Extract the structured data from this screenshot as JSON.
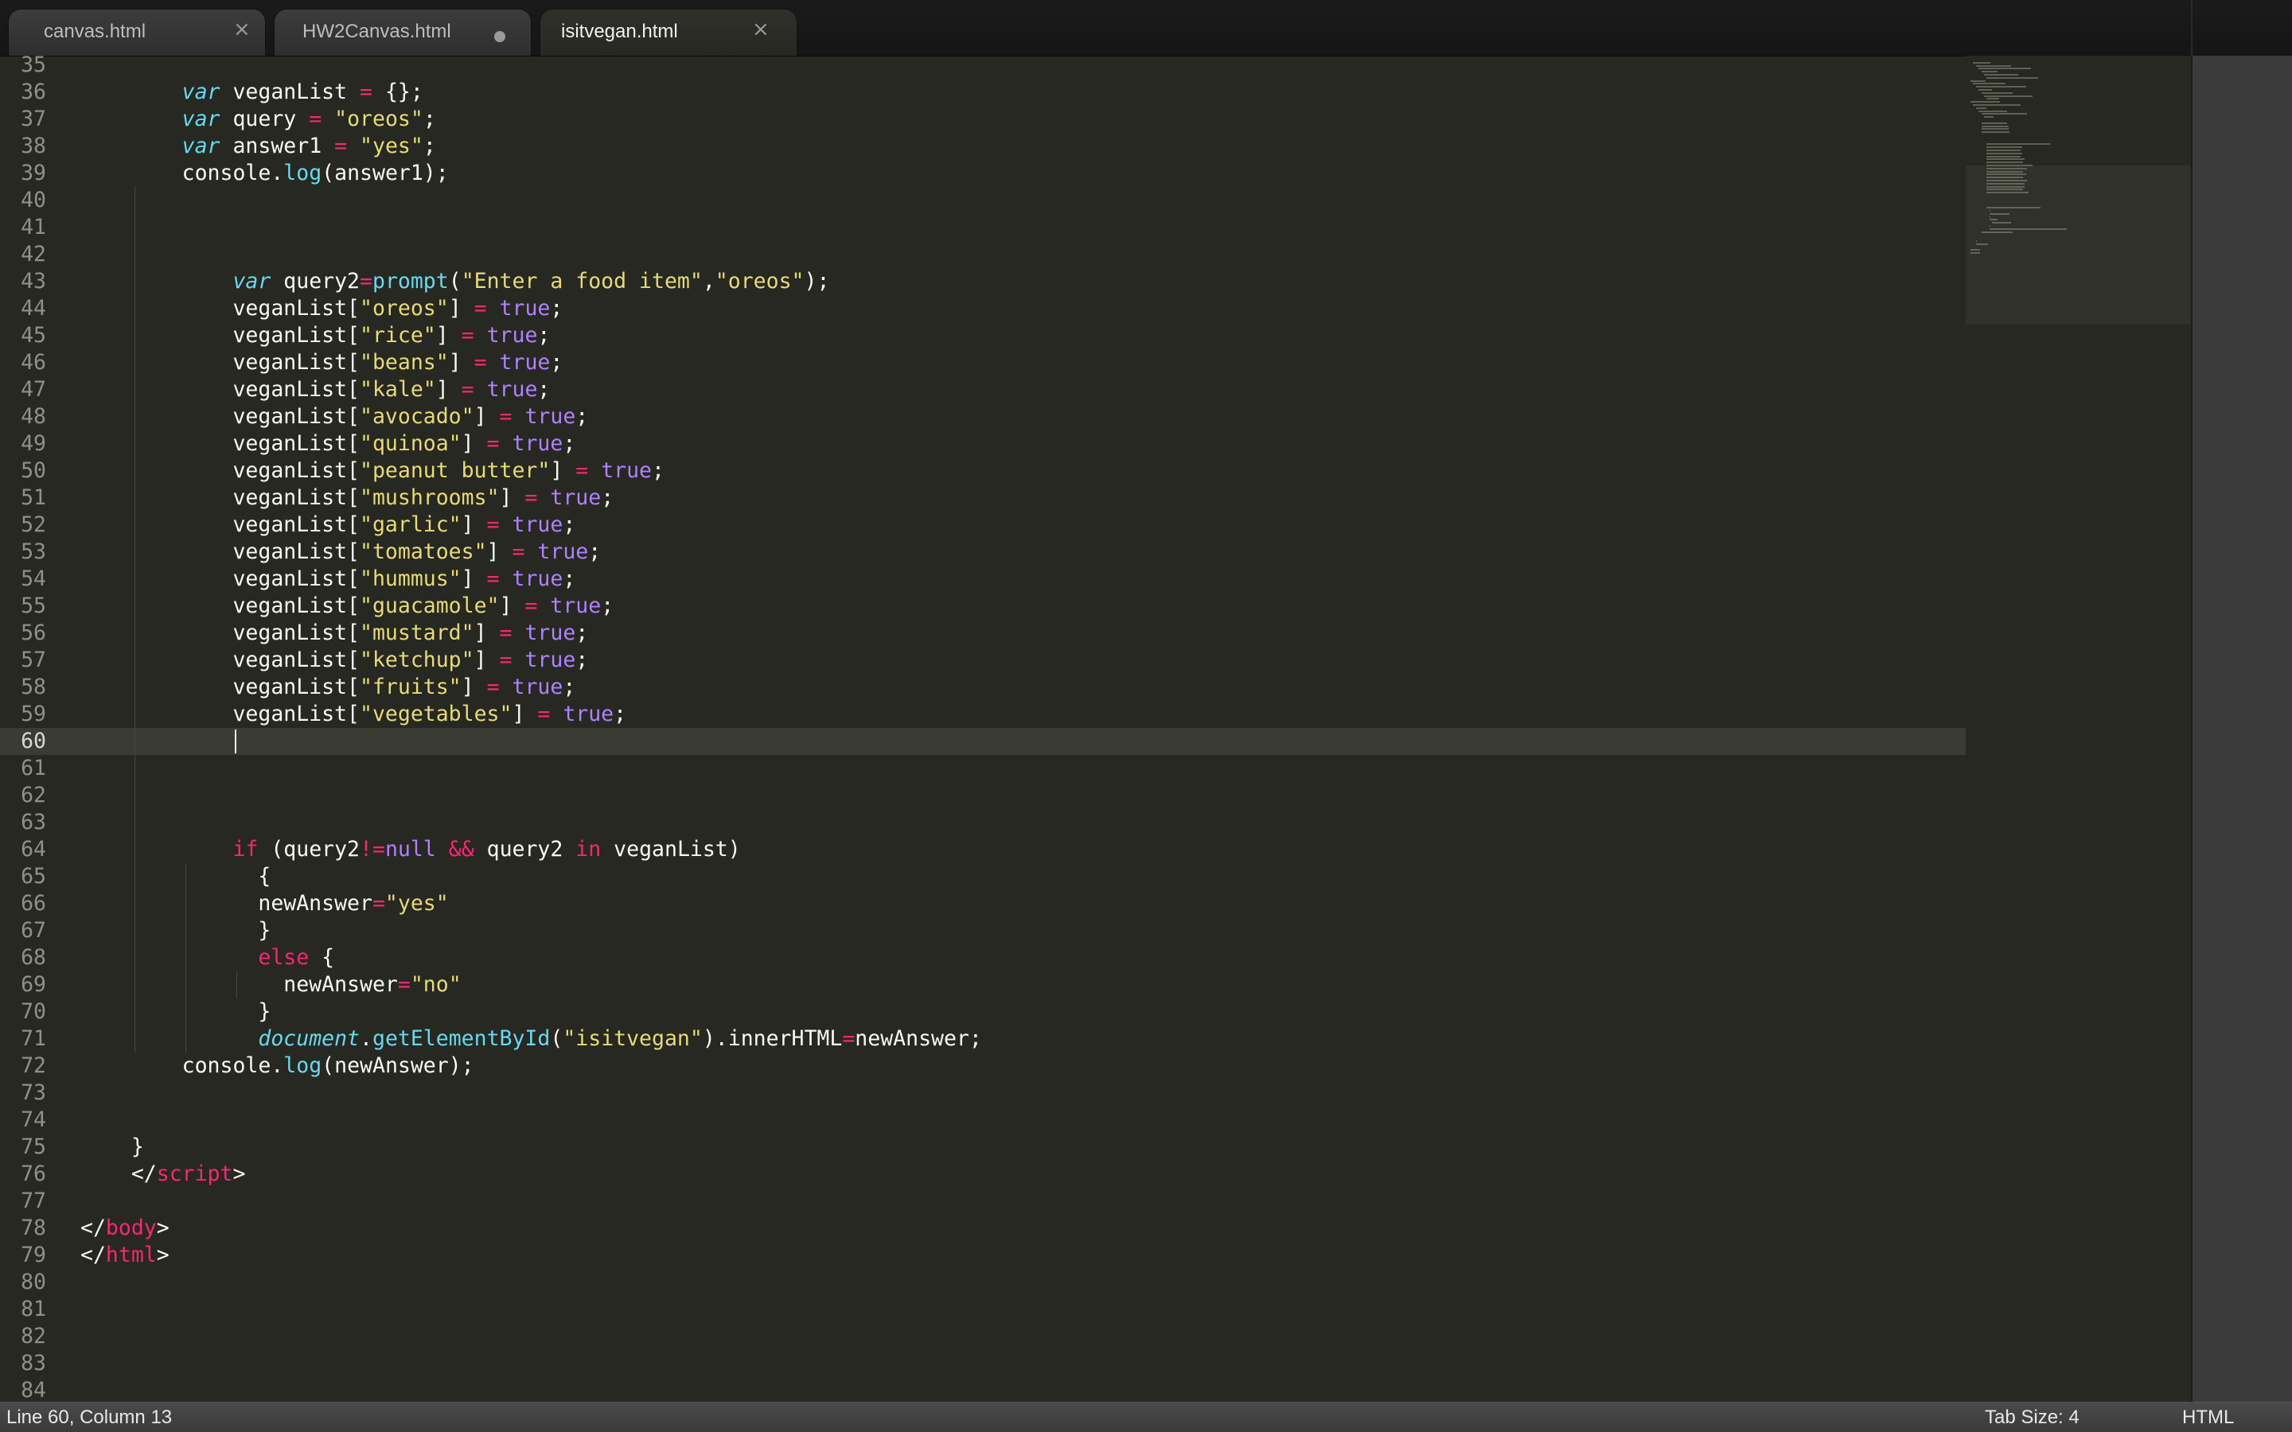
{
  "tabs": [
    {
      "label": "canvas.html",
      "state": "close"
    },
    {
      "label": "HW2Canvas.html",
      "state": "modified"
    },
    {
      "label": "isitvegan.html",
      "state": "close",
      "active": true
    }
  ],
  "icons": {
    "close": "×"
  },
  "editor": {
    "theme": {
      "background": "#272822",
      "keyword": "#f92672",
      "string": "#e6db74",
      "function": "#66d9ef",
      "constant": "#ae81ff",
      "text": "#f8f8f2"
    },
    "current_line": "60",
    "lines": [
      {
        "n": "35",
        "tokens": []
      },
      {
        "n": "36",
        "tokens": [
          {
            "t": "        "
          },
          {
            "t": "var",
            "c": "kw-i"
          },
          {
            "t": " veganList "
          },
          {
            "t": "=",
            "c": "kw"
          },
          {
            "t": " {};"
          }
        ]
      },
      {
        "n": "37",
        "tokens": [
          {
            "t": "        "
          },
          {
            "t": "var",
            "c": "kw-i"
          },
          {
            "t": " query "
          },
          {
            "t": "=",
            "c": "kw"
          },
          {
            "t": " "
          },
          {
            "t": "\"oreos\"",
            "c": "str"
          },
          {
            "t": ";"
          }
        ]
      },
      {
        "n": "38",
        "tokens": [
          {
            "t": "        "
          },
          {
            "t": "var",
            "c": "kw-i"
          },
          {
            "t": " answer1 "
          },
          {
            "t": "=",
            "c": "kw"
          },
          {
            "t": " "
          },
          {
            "t": "\"yes\"",
            "c": "str"
          },
          {
            "t": ";"
          }
        ]
      },
      {
        "n": "39",
        "tokens": [
          {
            "t": "        console"
          },
          {
            "t": ".",
            "c": "plain"
          },
          {
            "t": "log",
            "c": "fn"
          },
          {
            "t": "(answer1);"
          }
        ]
      },
      {
        "n": "40",
        "tokens": []
      },
      {
        "n": "41",
        "tokens": []
      },
      {
        "n": "42",
        "tokens": []
      },
      {
        "n": "43",
        "tokens": [
          {
            "t": "            "
          },
          {
            "t": "var",
            "c": "kw-i"
          },
          {
            "t": " query2"
          },
          {
            "t": "=",
            "c": "kw"
          },
          {
            "t": "prompt",
            "c": "fn"
          },
          {
            "t": "("
          },
          {
            "t": "\"Enter a food item\"",
            "c": "str"
          },
          {
            "t": ","
          },
          {
            "t": "\"oreos\"",
            "c": "str"
          },
          {
            "t": ");"
          }
        ]
      },
      {
        "n": "44",
        "tokens": [
          {
            "t": "            veganList["
          },
          {
            "t": "\"oreos\"",
            "c": "str"
          },
          {
            "t": "] "
          },
          {
            "t": "=",
            "c": "kw"
          },
          {
            "t": " "
          },
          {
            "t": "true",
            "c": "num"
          },
          {
            "t": ";"
          }
        ]
      },
      {
        "n": "45",
        "tokens": [
          {
            "t": "            veganList["
          },
          {
            "t": "\"rice\"",
            "c": "str"
          },
          {
            "t": "] "
          },
          {
            "t": "=",
            "c": "kw"
          },
          {
            "t": " "
          },
          {
            "t": "true",
            "c": "num"
          },
          {
            "t": ";"
          }
        ]
      },
      {
        "n": "46",
        "tokens": [
          {
            "t": "            veganList["
          },
          {
            "t": "\"beans\"",
            "c": "str"
          },
          {
            "t": "] "
          },
          {
            "t": "=",
            "c": "kw"
          },
          {
            "t": " "
          },
          {
            "t": "true",
            "c": "num"
          },
          {
            "t": ";"
          }
        ]
      },
      {
        "n": "47",
        "tokens": [
          {
            "t": "            veganList["
          },
          {
            "t": "\"kale\"",
            "c": "str"
          },
          {
            "t": "] "
          },
          {
            "t": "=",
            "c": "kw"
          },
          {
            "t": " "
          },
          {
            "t": "true",
            "c": "num"
          },
          {
            "t": ";"
          }
        ]
      },
      {
        "n": "48",
        "tokens": [
          {
            "t": "            veganList["
          },
          {
            "t": "\"avocado\"",
            "c": "str"
          },
          {
            "t": "] "
          },
          {
            "t": "=",
            "c": "kw"
          },
          {
            "t": " "
          },
          {
            "t": "true",
            "c": "num"
          },
          {
            "t": ";"
          }
        ]
      },
      {
        "n": "49",
        "tokens": [
          {
            "t": "            veganList["
          },
          {
            "t": "\"quinoa\"",
            "c": "str"
          },
          {
            "t": "] "
          },
          {
            "t": "=",
            "c": "kw"
          },
          {
            "t": " "
          },
          {
            "t": "true",
            "c": "num"
          },
          {
            "t": ";"
          }
        ]
      },
      {
        "n": "50",
        "tokens": [
          {
            "t": "            veganList["
          },
          {
            "t": "\"peanut butter\"",
            "c": "str"
          },
          {
            "t": "] "
          },
          {
            "t": "=",
            "c": "kw"
          },
          {
            "t": " "
          },
          {
            "t": "true",
            "c": "num"
          },
          {
            "t": ";"
          }
        ]
      },
      {
        "n": "51",
        "tokens": [
          {
            "t": "            veganList["
          },
          {
            "t": "\"mushrooms\"",
            "c": "str"
          },
          {
            "t": "] "
          },
          {
            "t": "=",
            "c": "kw"
          },
          {
            "t": " "
          },
          {
            "t": "true",
            "c": "num"
          },
          {
            "t": ";"
          }
        ]
      },
      {
        "n": "52",
        "tokens": [
          {
            "t": "            veganList["
          },
          {
            "t": "\"garlic\"",
            "c": "str"
          },
          {
            "t": "] "
          },
          {
            "t": "=",
            "c": "kw"
          },
          {
            "t": " "
          },
          {
            "t": "true",
            "c": "num"
          },
          {
            "t": ";"
          }
        ]
      },
      {
        "n": "53",
        "tokens": [
          {
            "t": "            veganList["
          },
          {
            "t": "\"tomatoes\"",
            "c": "str"
          },
          {
            "t": "] "
          },
          {
            "t": "=",
            "c": "kw"
          },
          {
            "t": " "
          },
          {
            "t": "true",
            "c": "num"
          },
          {
            "t": ";"
          }
        ]
      },
      {
        "n": "54",
        "tokens": [
          {
            "t": "            veganList["
          },
          {
            "t": "\"hummus\"",
            "c": "str"
          },
          {
            "t": "] "
          },
          {
            "t": "=",
            "c": "kw"
          },
          {
            "t": " "
          },
          {
            "t": "true",
            "c": "num"
          },
          {
            "t": ";"
          }
        ]
      },
      {
        "n": "55",
        "tokens": [
          {
            "t": "            veganList["
          },
          {
            "t": "\"guacamole\"",
            "c": "str"
          },
          {
            "t": "] "
          },
          {
            "t": "=",
            "c": "kw"
          },
          {
            "t": " "
          },
          {
            "t": "true",
            "c": "num"
          },
          {
            "t": ";"
          }
        ]
      },
      {
        "n": "56",
        "tokens": [
          {
            "t": "            veganList["
          },
          {
            "t": "\"mustard\"",
            "c": "str"
          },
          {
            "t": "] "
          },
          {
            "t": "=",
            "c": "kw"
          },
          {
            "t": " "
          },
          {
            "t": "true",
            "c": "num"
          },
          {
            "t": ";"
          }
        ]
      },
      {
        "n": "57",
        "tokens": [
          {
            "t": "            veganList["
          },
          {
            "t": "\"ketchup\"",
            "c": "str"
          },
          {
            "t": "] "
          },
          {
            "t": "=",
            "c": "kw"
          },
          {
            "t": " "
          },
          {
            "t": "true",
            "c": "num"
          },
          {
            "t": ";"
          }
        ]
      },
      {
        "n": "58",
        "tokens": [
          {
            "t": "            veganList["
          },
          {
            "t": "\"fruits\"",
            "c": "str"
          },
          {
            "t": "] "
          },
          {
            "t": "=",
            "c": "kw"
          },
          {
            "t": " "
          },
          {
            "t": "true",
            "c": "num"
          },
          {
            "t": ";"
          }
        ]
      },
      {
        "n": "59",
        "tokens": [
          {
            "t": "            veganList["
          },
          {
            "t": "\"vegetables\"",
            "c": "str"
          },
          {
            "t": "] "
          },
          {
            "t": "=",
            "c": "kw"
          },
          {
            "t": " "
          },
          {
            "t": "true",
            "c": "num"
          },
          {
            "t": ";"
          }
        ]
      },
      {
        "n": "60",
        "tokens": []
      },
      {
        "n": "61",
        "tokens": []
      },
      {
        "n": "62",
        "tokens": []
      },
      {
        "n": "63",
        "tokens": []
      },
      {
        "n": "64",
        "tokens": [
          {
            "t": "            "
          },
          {
            "t": "if",
            "c": "kw"
          },
          {
            "t": " (query2"
          },
          {
            "t": "!=",
            "c": "kw"
          },
          {
            "t": "null",
            "c": "num"
          },
          {
            "t": " "
          },
          {
            "t": "&&",
            "c": "kw"
          },
          {
            "t": " query2 "
          },
          {
            "t": "in",
            "c": "kw"
          },
          {
            "t": " veganList)"
          }
        ]
      },
      {
        "n": "65",
        "tokens": [
          {
            "t": "              {"
          }
        ]
      },
      {
        "n": "66",
        "tokens": [
          {
            "t": "              newAnswer"
          },
          {
            "t": "=",
            "c": "kw"
          },
          {
            "t": "\"yes\"",
            "c": "str"
          }
        ]
      },
      {
        "n": "67",
        "tokens": [
          {
            "t": "              }"
          }
        ]
      },
      {
        "n": "68",
        "tokens": [
          {
            "t": "              "
          },
          {
            "t": "else",
            "c": "kw"
          },
          {
            "t": " {"
          }
        ]
      },
      {
        "n": "69",
        "tokens": [
          {
            "t": "                newAnswer"
          },
          {
            "t": "=",
            "c": "kw"
          },
          {
            "t": "\"no\"",
            "c": "str"
          }
        ]
      },
      {
        "n": "70",
        "tokens": [
          {
            "t": "              }"
          }
        ]
      },
      {
        "n": "71",
        "tokens": [
          {
            "t": "              "
          },
          {
            "t": "document",
            "c": "obj"
          },
          {
            "t": "."
          },
          {
            "t": "getElementById",
            "c": "fn"
          },
          {
            "t": "("
          },
          {
            "t": "\"isitvegan\"",
            "c": "str"
          },
          {
            "t": ").innerHTML"
          },
          {
            "t": "=",
            "c": "kw"
          },
          {
            "t": "newAnswer;"
          }
        ]
      },
      {
        "n": "72",
        "tokens": [
          {
            "t": "        console"
          },
          {
            "t": "."
          },
          {
            "t": "log",
            "c": "fn"
          },
          {
            "t": "(newAnswer);"
          }
        ]
      },
      {
        "n": "73",
        "tokens": []
      },
      {
        "n": "74",
        "tokens": []
      },
      {
        "n": "75",
        "tokens": [
          {
            "t": "    }"
          }
        ]
      },
      {
        "n": "76",
        "tokens": [
          {
            "t": "    </"
          },
          {
            "t": "script",
            "c": "kw"
          },
          {
            "t": ">"
          }
        ]
      },
      {
        "n": "77",
        "tokens": []
      },
      {
        "n": "78",
        "tokens": [
          {
            "t": "</"
          },
          {
            "t": "body",
            "c": "kw"
          },
          {
            "t": ">"
          }
        ]
      },
      {
        "n": "79",
        "tokens": [
          {
            "t": "</"
          },
          {
            "t": "html",
            "c": "kw"
          },
          {
            "t": ">"
          }
        ]
      },
      {
        "n": "80",
        "tokens": []
      },
      {
        "n": "81",
        "tokens": []
      },
      {
        "n": "82",
        "tokens": []
      },
      {
        "n": "83",
        "tokens": []
      },
      {
        "n": "84",
        "tokens": []
      }
    ]
  },
  "status": {
    "position": "Line 60, Column 13",
    "tab_size": "Tab Size: 4",
    "syntax": "HTML"
  }
}
